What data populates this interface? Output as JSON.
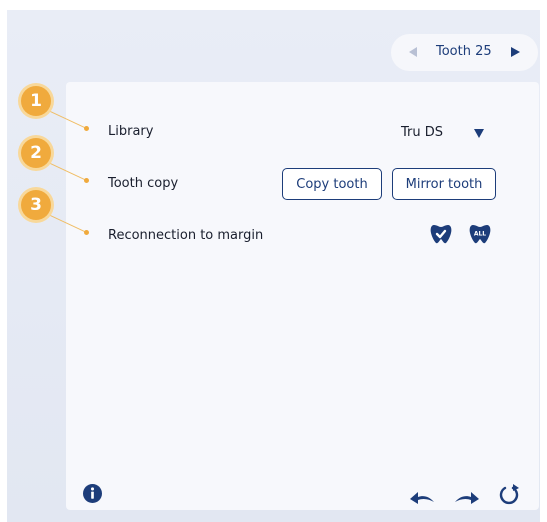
{
  "navigator": {
    "label": "Tooth 25"
  },
  "callouts": [
    "1",
    "2",
    "3"
  ],
  "rows": {
    "library": {
      "label": "Library",
      "value": "Tru DS"
    },
    "tooth_copy": {
      "label": "Tooth copy",
      "copy_button": "Copy tooth",
      "mirror_button": "Mirror tooth"
    },
    "reconnection": {
      "label": "Reconnection to margin",
      "all_icon_text": "ALL"
    }
  },
  "icons": {
    "info": "info-icon",
    "undo": "undo-icon",
    "redo": "redo-icon",
    "reset": "reset-icon",
    "prev": "triangle-left-icon",
    "next": "triangle-right-icon",
    "dropdown": "triangle-down-icon",
    "tooth_check": "tooth-check-icon",
    "tooth_all": "tooth-all-icon"
  },
  "colors": {
    "accent": "#1d3d7a",
    "callout": "#f0aa3d",
    "panel": "#f7f8fc",
    "background": "#e5e9f3"
  }
}
